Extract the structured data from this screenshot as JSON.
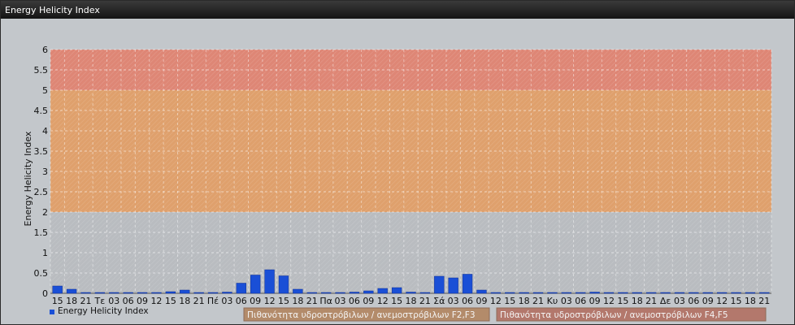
{
  "window": {
    "title": "Energy Helicity Index"
  },
  "chart_data": {
    "type": "bar",
    "title": "",
    "ylabel": "Energy Helicity Index",
    "xlabel": "",
    "ylim": [
      0,
      6
    ],
    "yticks": [
      0,
      0.5,
      1,
      1.5,
      2,
      2.5,
      3,
      3.5,
      4,
      4.5,
      5,
      5.5,
      6
    ],
    "categories": [
      "15",
      "18",
      "21",
      "Τε",
      "03",
      "06",
      "09",
      "12",
      "15",
      "18",
      "21",
      "Πέ",
      "03",
      "06",
      "09",
      "12",
      "15",
      "18",
      "21",
      "Πα",
      "03",
      "06",
      "09",
      "12",
      "15",
      "18",
      "21",
      "Σά",
      "03",
      "06",
      "09",
      "12",
      "15",
      "18",
      "21",
      "Κυ",
      "03",
      "06",
      "09",
      "12",
      "15",
      "18",
      "21",
      "Δε",
      "03",
      "06",
      "09",
      "12",
      "15",
      "18",
      "21"
    ],
    "series": [
      {
        "name": "Energy Helicity Index",
        "color": "#1a4fd6",
        "values": [
          0.18,
          0.1,
          0.02,
          0.02,
          0.02,
          0.02,
          0.02,
          0.02,
          0.04,
          0.08,
          0.02,
          0.02,
          0.03,
          0.25,
          0.45,
          0.58,
          0.43,
          0.1,
          0.02,
          0.02,
          0.02,
          0.03,
          0.06,
          0.12,
          0.14,
          0.03,
          0.02,
          0.42,
          0.38,
          0.47,
          0.08,
          0.02,
          0.02,
          0.02,
          0.02,
          0.02,
          0.02,
          0.02,
          0.03,
          0.02,
          0.02,
          0.02,
          0.02,
          0.02,
          0.02,
          0.02,
          0.02,
          0.02,
          0.02,
          0.02,
          0.02
        ]
      }
    ],
    "bands": [
      {
        "from": 2,
        "to": 5,
        "color": "#dfa06c",
        "label": "Πιθανότητα υδροστρόβιλων / ανεμοστρόβιλων F2,F3"
      },
      {
        "from": 5,
        "to": 6,
        "color": "#de8675",
        "label": "Πιθανότητα υδροστρόβιλων / ανεμοστρόβιλων F4,F5"
      }
    ],
    "grid": true,
    "legend": "bottom-left"
  }
}
